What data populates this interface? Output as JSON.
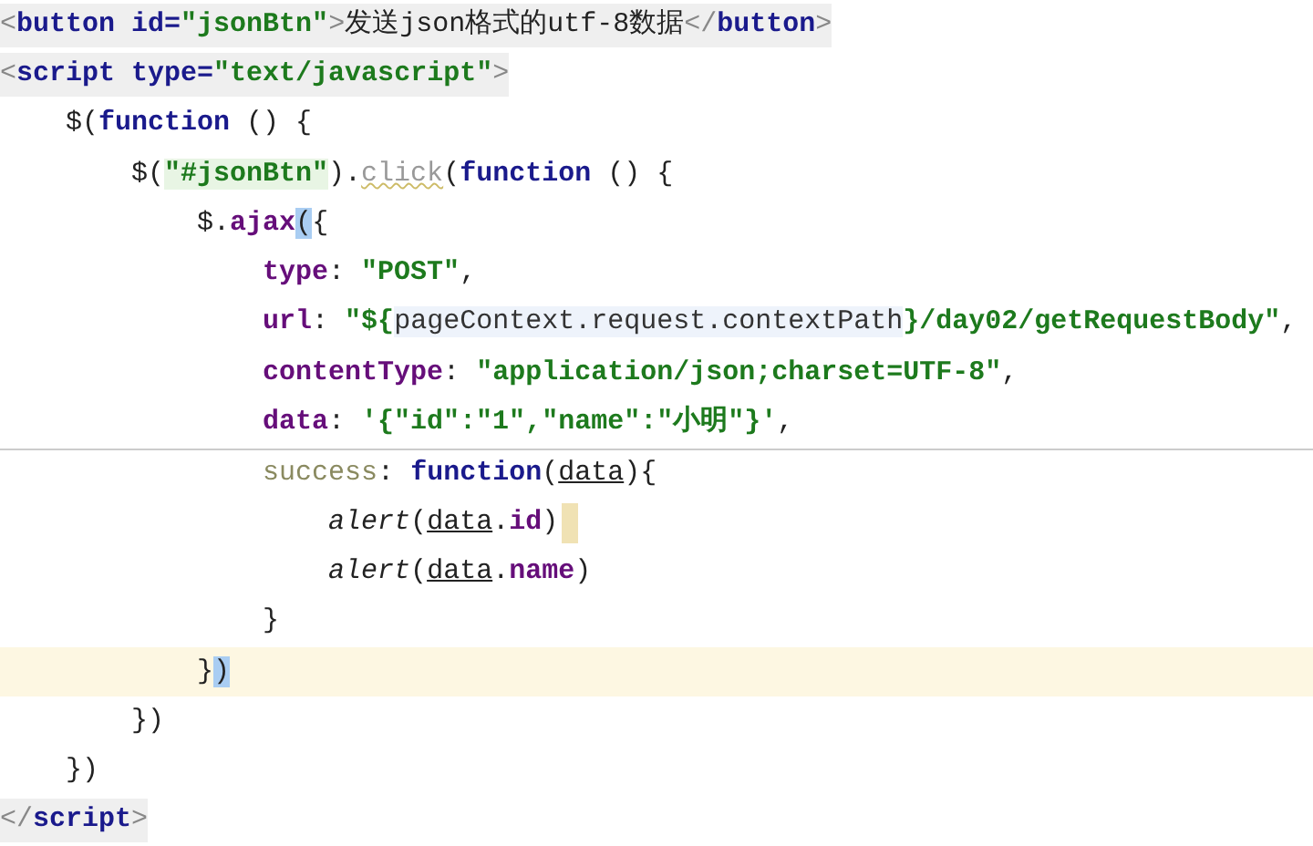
{
  "editor": {
    "lines": [
      {
        "kind": "markup",
        "current": false,
        "separator": false,
        "marker": false,
        "tokens": [
          {
            "text": "<",
            "kind": "punct"
          },
          {
            "text": "button",
            "kind": "tag"
          },
          {
            "text": " id=",
            "kind": "tag"
          },
          {
            "text": "\"jsonBtn\"",
            "kind": "string"
          },
          {
            "text": ">",
            "kind": "punct"
          },
          {
            "text": "发送json格式的utf-8数据",
            "kind": "plain"
          },
          {
            "text": "</",
            "kind": "punct"
          },
          {
            "text": "button",
            "kind": "tag"
          },
          {
            "text": ">",
            "kind": "punct"
          }
        ]
      },
      {
        "kind": "markup",
        "current": false,
        "separator": false,
        "marker": false,
        "tokens": [
          {
            "text": "<",
            "kind": "punct"
          },
          {
            "text": "script",
            "kind": "tag"
          },
          {
            "text": " type=",
            "kind": "tag"
          },
          {
            "text": "\"text/javascript\"",
            "kind": "string"
          },
          {
            "text": ">",
            "kind": "punct"
          }
        ]
      },
      {
        "kind": "script",
        "current": false,
        "separator": false,
        "marker": false,
        "tokens": [
          {
            "text": "    $(",
            "kind": "plain"
          },
          {
            "text": "function",
            "kind": "keyword"
          },
          {
            "text": " () {",
            "kind": "plain"
          }
        ]
      },
      {
        "kind": "script",
        "current": false,
        "separator": false,
        "marker": false,
        "tokens": [
          {
            "text": "        $(",
            "kind": "plain"
          },
          {
            "text": "\"#jsonBtn\"",
            "kind": "selector"
          },
          {
            "text": ").",
            "kind": "plain"
          },
          {
            "text": "click",
            "kind": "method"
          },
          {
            "text": "(",
            "kind": "plain"
          },
          {
            "text": "function",
            "kind": "keyword"
          },
          {
            "text": " () {",
            "kind": "plain"
          }
        ]
      },
      {
        "kind": "script",
        "current": false,
        "separator": false,
        "marker": false,
        "tokens": [
          {
            "text": "            $.",
            "kind": "plain"
          },
          {
            "text": "ajax",
            "kind": "prop"
          },
          {
            "text": "(",
            "kind": "plain",
            "matched": true
          },
          {
            "text": "{",
            "kind": "plain"
          }
        ]
      },
      {
        "kind": "script",
        "current": false,
        "separator": false,
        "marker": false,
        "tokens": [
          {
            "text": "                type",
            "kind": "prop"
          },
          {
            "text": ": ",
            "kind": "plain"
          },
          {
            "text": "\"POST\"",
            "kind": "string"
          },
          {
            "text": ",",
            "kind": "plain"
          }
        ]
      },
      {
        "kind": "script",
        "current": false,
        "separator": false,
        "marker": false,
        "tokens": [
          {
            "text": "                url",
            "kind": "prop"
          },
          {
            "text": ": ",
            "kind": "plain"
          },
          {
            "text": "\"${",
            "kind": "string"
          },
          {
            "text": "pageContext.request.contextPath",
            "kind": "injected"
          },
          {
            "text": "}/day02/getRequestBody\"",
            "kind": "string"
          },
          {
            "text": ",",
            "kind": "plain"
          }
        ]
      },
      {
        "kind": "script",
        "current": false,
        "separator": false,
        "marker": false,
        "tokens": [
          {
            "text": "                contentType",
            "kind": "prop"
          },
          {
            "text": ": ",
            "kind": "plain"
          },
          {
            "text": "\"application/json;charset=UTF-8\"",
            "kind": "string"
          },
          {
            "text": ",",
            "kind": "plain"
          }
        ]
      },
      {
        "kind": "script",
        "current": false,
        "separator": false,
        "marker": false,
        "tokens": [
          {
            "text": "                data",
            "kind": "prop"
          },
          {
            "text": ": ",
            "kind": "plain"
          },
          {
            "text": "'{\"id\":\"1\",\"name\":\"小明\"}'",
            "kind": "string"
          },
          {
            "text": ",",
            "kind": "plain"
          }
        ]
      },
      {
        "kind": "script",
        "current": false,
        "separator": true,
        "marker": false,
        "tokens": [
          {
            "text": "                success",
            "kind": "label"
          },
          {
            "text": ": ",
            "kind": "plain"
          },
          {
            "text": "function",
            "kind": "keyword"
          },
          {
            "text": "(",
            "kind": "plain"
          },
          {
            "text": "data",
            "kind": "param"
          },
          {
            "text": "){",
            "kind": "plain"
          }
        ]
      },
      {
        "kind": "script",
        "current": false,
        "separator": false,
        "marker": true,
        "tokens": [
          {
            "text": "                    alert",
            "kind": "italic"
          },
          {
            "text": "(",
            "kind": "plain"
          },
          {
            "text": "data",
            "kind": "param"
          },
          {
            "text": ".",
            "kind": "plain"
          },
          {
            "text": "id",
            "kind": "prop"
          },
          {
            "text": ")",
            "kind": "plain"
          }
        ]
      },
      {
        "kind": "script",
        "current": false,
        "separator": false,
        "marker": false,
        "tokens": [
          {
            "text": "                    alert",
            "kind": "italic"
          },
          {
            "text": "(",
            "kind": "plain"
          },
          {
            "text": "data",
            "kind": "param"
          },
          {
            "text": ".",
            "kind": "plain"
          },
          {
            "text": "name",
            "kind": "prop"
          },
          {
            "text": ")",
            "kind": "plain"
          }
        ]
      },
      {
        "kind": "script",
        "current": false,
        "separator": false,
        "marker": false,
        "tokens": [
          {
            "text": "                }",
            "kind": "plain"
          }
        ]
      },
      {
        "kind": "script",
        "current": true,
        "separator": false,
        "marker": false,
        "tokens": [
          {
            "text": "            }",
            "kind": "plain"
          },
          {
            "text": ")",
            "kind": "plain",
            "matched": true
          }
        ]
      },
      {
        "kind": "script",
        "current": false,
        "separator": false,
        "marker": false,
        "tokens": [
          {
            "text": "        })",
            "kind": "plain"
          }
        ]
      },
      {
        "kind": "script",
        "current": false,
        "separator": false,
        "marker": false,
        "tokens": [
          {
            "text": "    })",
            "kind": "plain"
          }
        ]
      },
      {
        "kind": "markup",
        "current": false,
        "separator": false,
        "marker": false,
        "tokens": [
          {
            "text": "</",
            "kind": "punct"
          },
          {
            "text": "script",
            "kind": "tag"
          },
          {
            "text": ">",
            "kind": "punct"
          }
        ]
      }
    ]
  }
}
